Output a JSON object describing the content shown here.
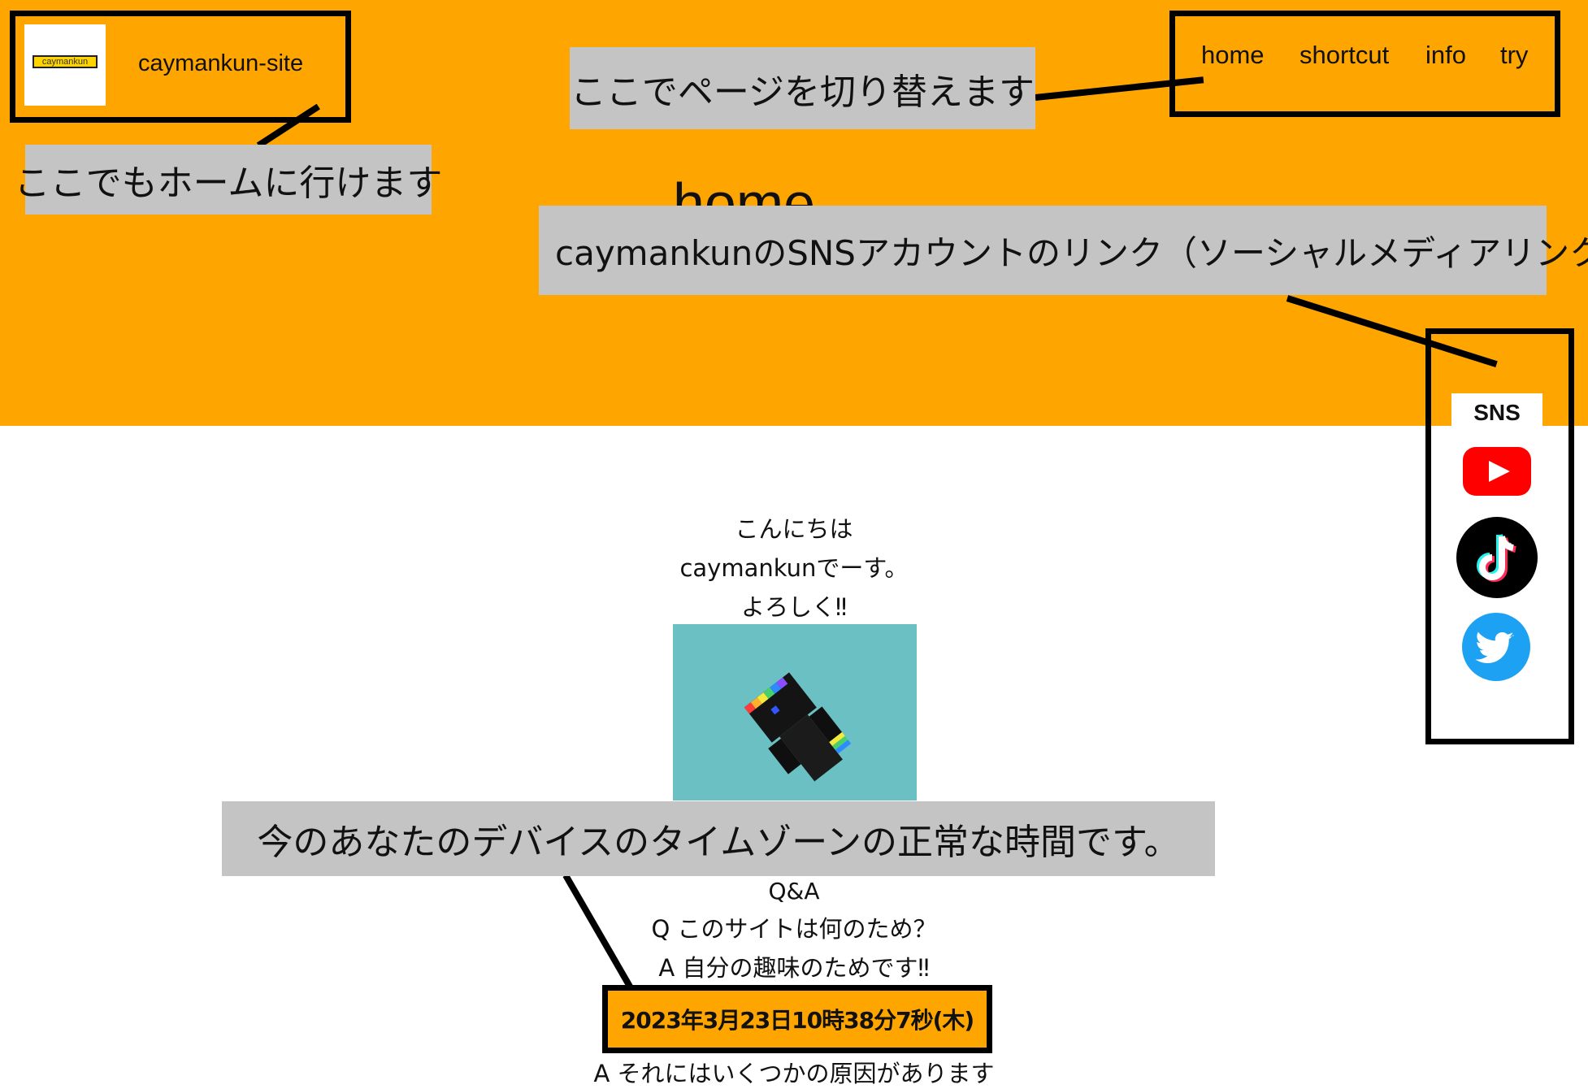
{
  "header": {
    "logo_text": "caymankun",
    "site_name": "caymankun-site",
    "page_heading": "home",
    "nav": [
      "home",
      "shortcut",
      "info",
      "try"
    ]
  },
  "annotations": {
    "nav_callout": "ここでページを切り替えます",
    "home_callout": "ここでもホームに行けます",
    "sns_callout": "caymankunのSNSアカウントのリンク（ソーシャルメディアリンク）",
    "clock_callout": "今のあなたのデバイスのタイムゾーンの正常な時間です。"
  },
  "sns": {
    "title": "SNS",
    "links": [
      {
        "icon": "youtube-icon",
        "color": "#FF0000"
      },
      {
        "icon": "tiktok-icon",
        "color": "#000000"
      },
      {
        "icon": "twitter-icon",
        "color": "#1DA1F2"
      }
    ]
  },
  "main": {
    "greeting_lines": [
      "こんにちは",
      "caymankunでーす。",
      "よろしく‼"
    ],
    "qa_title": "Q&A",
    "qa_question": "Q このサイトは何のため？",
    "qa_answer": "A 自分の趣味のためです‼",
    "clock_text": "2023年3月23日10時38分7秒(木)",
    "footer_text": "A それにはいくつかの原因があります"
  },
  "colors": {
    "header_bg": "#FFA500",
    "callout_bg": "#C4C4C4",
    "frame": "#000000",
    "image_bg": "#6AC0C3"
  }
}
